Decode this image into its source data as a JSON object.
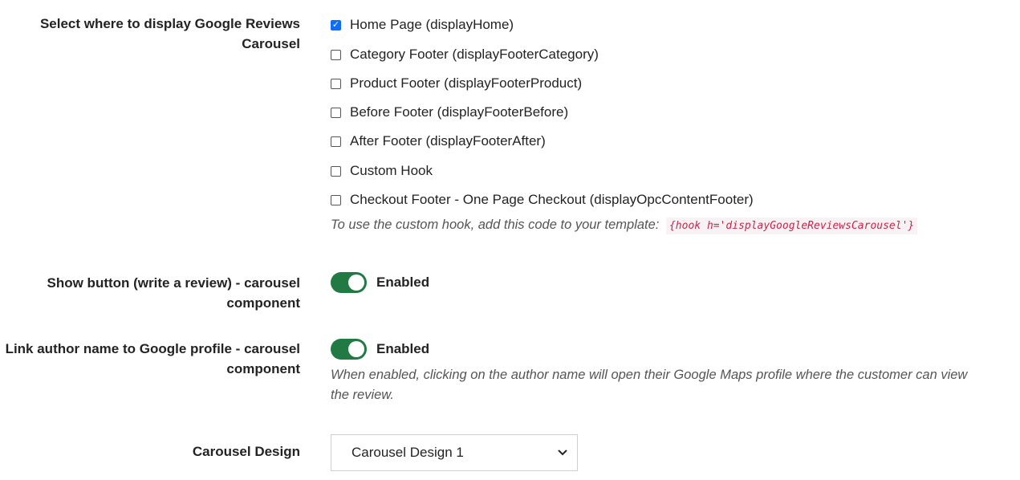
{
  "display_locations": {
    "label_line1": "Select where to display Google Reviews",
    "label_line2": "Carousel",
    "options": [
      {
        "label": "Home Page (displayHome)",
        "checked": true
      },
      {
        "label": "Category Footer (displayFooterCategory)",
        "checked": false
      },
      {
        "label": "Product Footer (displayFooterProduct)",
        "checked": false
      },
      {
        "label": "Before Footer (displayFooterBefore)",
        "checked": false
      },
      {
        "label": "After Footer (displayFooterAfter)",
        "checked": false
      },
      {
        "label": "Custom Hook",
        "checked": false
      },
      {
        "label": "Checkout Footer - One Page Checkout (displayOpcContentFooter)",
        "checked": false
      }
    ],
    "help_text": "To use the custom hook, add this code to your template:",
    "hook_code": "{hook h='displayGoogleReviewsCarousel'}"
  },
  "show_button": {
    "label_line1": "Show button (write a review) - carousel",
    "label_line2": "component",
    "status": "Enabled",
    "enabled": true
  },
  "link_author": {
    "label_line1": "Link author name to Google profile - carousel",
    "label_line2": "component",
    "status": "Enabled",
    "enabled": true,
    "help_line1": "When enabled, clicking on the author name will open their Google Maps profile where the customer can view",
    "help_line2": "the review."
  },
  "carousel_design": {
    "label": "Carousel Design",
    "selected": "Carousel Design 1"
  },
  "colors": {
    "toggle_on": "#217a43",
    "checkbox_checked": "#0d6efd",
    "code_text": "#c7254e",
    "code_bg": "#f9f2f4"
  }
}
